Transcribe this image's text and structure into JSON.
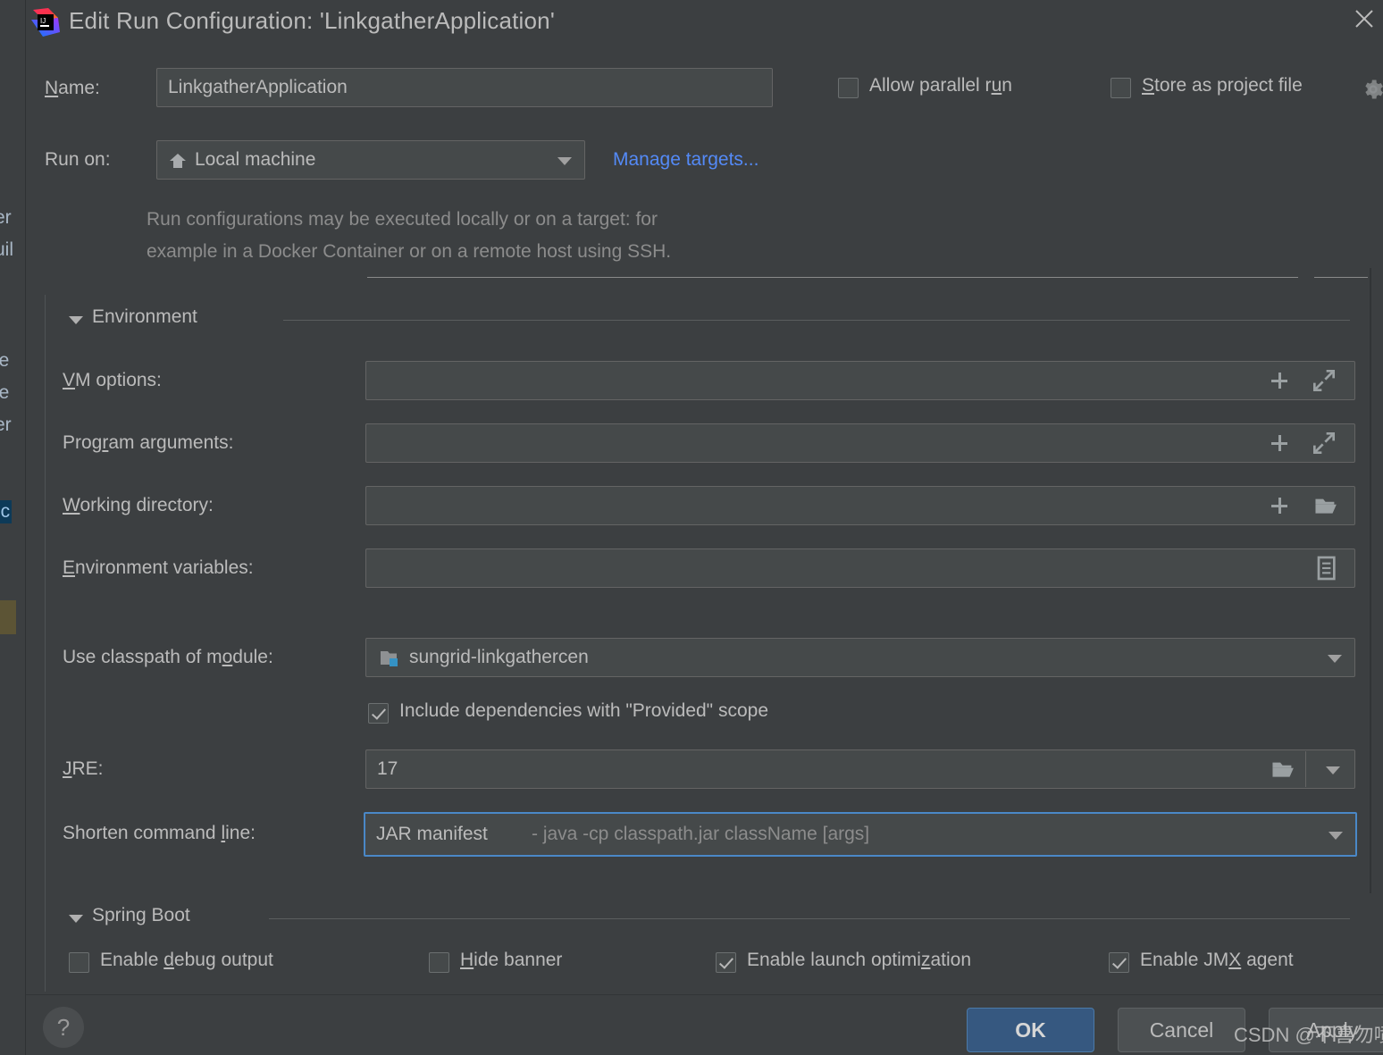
{
  "window": {
    "title": "Edit Run Configuration: 'LinkgatherApplication'",
    "logo_icon": "intellij-idea-logo",
    "close_icon": "close-icon"
  },
  "form": {
    "name_label": "Name:",
    "name_mnemonic": "N",
    "name_value": "LinkgatherApplication",
    "run_on_label": "Run on:",
    "run_on_value": "Local machine",
    "run_on_icon": "home-icon",
    "manage_targets_link": "Manage targets...",
    "target_description_line1": "Run configurations may be executed locally or on a target: for",
    "target_description_line2": "example in a Docker Container or on a remote host using SSH.",
    "allow_parallel_run_label": "Allow parallel run",
    "allow_parallel_run_mnemonic": "u",
    "allow_parallel_run_checked": false,
    "store_as_project_file_label": "Store as project file",
    "store_as_project_file_mnemonic": "S",
    "store_as_project_file_checked": false,
    "gear_icon": "gear-icon"
  },
  "environment": {
    "section_title": "Environment",
    "section_mnemonic": "m",
    "expanded": true,
    "vm_options_label": "VM options:",
    "vm_options_mnemonic": "V",
    "vm_options_value": "",
    "program_arguments_label": "Program arguments:",
    "program_arguments_mnemonic": "r",
    "program_arguments_value": "",
    "working_directory_label": "Working directory:",
    "working_directory_mnemonic": "W",
    "working_directory_value": "",
    "environment_variables_label": "Environment variables:",
    "environment_variables_mnemonic": "E",
    "environment_variables_value": "",
    "use_classpath_label": "Use classpath of module:",
    "use_classpath_mnemonic": "o",
    "use_classpath_value": "sungrid-linkgathercen",
    "module_icon": "module-folder-icon",
    "include_provided_label": "Include dependencies with \"Provided\" scope",
    "include_provided_checked": true,
    "jre_label": "JRE:",
    "jre_mnemonic": "J",
    "jre_value": "17",
    "shorten_label": "Shorten command line:",
    "shorten_mnemonic": "l",
    "shorten_value": "JAR manifest",
    "shorten_hint": "- java -cp classpath.jar className [args]",
    "icons": {
      "add": "plus-icon",
      "expand": "expand-arrows-icon",
      "browse": "folder-open-icon",
      "list": "list-editor-icon"
    }
  },
  "spring_boot": {
    "section_title": "Spring Boot",
    "section_mnemonic": "g",
    "expanded": true,
    "options": [
      {
        "label": "Enable debug output",
        "mnemonic": "d",
        "checked": false
      },
      {
        "label": "Hide banner",
        "mnemonic": "H",
        "checked": false
      },
      {
        "label": "Enable launch optimization",
        "mnemonic": "z",
        "checked": true
      },
      {
        "label": "Enable JMX agent",
        "mnemonic": "X",
        "checked": true
      }
    ]
  },
  "footer": {
    "help_label": "?",
    "ok_label": "OK",
    "cancel_label": "Cancel",
    "apply_label": "Apply"
  },
  "watermark": "CSDN @不喜勿喷",
  "ide_background": {
    "lines": [
      "er",
      "uil",
      "le",
      "le",
      "er",
      "ic"
    ]
  },
  "colors": {
    "dialog_bg": "#3c3f41",
    "field_bg": "#45494a",
    "border": "#646464",
    "text": "#bbbbbb",
    "muted_text": "#8c8c8c",
    "link": "#548af7",
    "focus_border": "#4a88c7",
    "primary_button": "#365880"
  }
}
